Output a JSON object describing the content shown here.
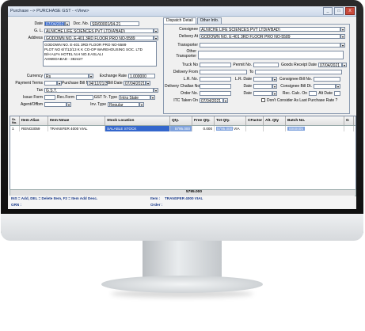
{
  "window": {
    "title": "Purchase --> PURCHASE GST - <View>",
    "minimize": "_",
    "maximize": "□",
    "close": "X"
  },
  "left": {
    "date_label": "Date",
    "date_value": "07/04/2021",
    "docno_label": "Doc. No.",
    "docno_value": "SR/00001/04-21",
    "gl_label": "G. L.",
    "gl_value": "ALNICHE LIFE SCIENCES PVT LTD(A'BAD)",
    "address_label": "Address",
    "address_line1": "GODOWN NO. E-401 3RD FLOOR PRO NO-5589",
    "address_block": [
      "GODOWN NO. E-401 3RD FLOOR PRO NO-5589",
      "PLOT NO 6/7/12/13 K K CO-OP WAREHOUSING SOC. LTD",
      "B/H ALFA HOTEL N.H NO.8 ASLALI",
      "AHMEDABAD - 382427"
    ],
    "currency_label": "Currency",
    "currency_value": "Rs",
    "exrate_label": "Exchange Rate",
    "exrate_value": "1.000000",
    "payterms_label": "Payment Terms",
    "purbill_label": "Purchase Bill No.",
    "purbill_value": "04/12/21/3/3",
    "billdate_label": "Bill Date",
    "billdate_value": "07/04/2021",
    "tax_label": "Tax",
    "tax_value": "G.S.T.",
    "issueform_label": "Issue Form",
    "recform_label": "Rec.Form",
    "gsttr_label": "GST Tr. Type",
    "gsttr_value": "Intra State",
    "agent_label": "Agent/Offbm",
    "invtype_label": "Inv. Type",
    "invtype_value": "Regular"
  },
  "tabs": [
    {
      "label": "Dispatch Detail"
    },
    {
      "label": "Other Info."
    }
  ],
  "right": {
    "consignee_label": "Consignee",
    "consignee_value": "ALNICHE LIFE SCIENCES PVT LTD(A'BAD)",
    "deliveryat_label": "Delivery At",
    "deliveryat_value": "GODOWN NO. E-401 3RD FLOOR PRO NO-5589",
    "transporter_label": "Transporter",
    "othertrans_label1": "Other",
    "othertrans_label2": "Transporter",
    "truck_label": "Truck No",
    "permit_label": "Permit No.",
    "goodsdate_label": "Goods Receipt Date",
    "goodsdate_value": "07/04/2021",
    "delfrom_label": "Delivery From",
    "to_label": "To",
    "lrno_label": "L.R. No.",
    "lrdate_label": "L.R. Date",
    "consbill_label": "Consignee Bill No.",
    "delchallan_label": "Delivery Challan No.",
    "date_label": "Date",
    "consbilldt_label": "Consignee Bill Dt.",
    "orderno_label": "Order No.",
    "order_date_label": "Date",
    "reccalc_label": "Rec. Calc. On",
    "altdate_label": "Alt Date",
    "itc_label": "ITC Taken On",
    "itc_value": "07/04/2021",
    "lastrate_label": "Don't Consider As Last Purchase Rate ?"
  },
  "grid": {
    "columns": [
      "Sr. No.",
      "Item Alias",
      "Item Nmae",
      "Stock Location",
      "Qty.",
      "Free Qty.",
      "Tot Qty.",
      "CFactor",
      "Alt. Qty",
      "Batch No.",
      "G"
    ],
    "rows": [
      {
        "sr": "1",
        "alias": "RENO3059",
        "name": "TRANSFER 4000 VIAL",
        "loc": "SALABLE STOCK",
        "qty": "5795.000",
        "free": "0.000",
        "tot": "5795.000",
        "unit": "VIA",
        "cf": "",
        "alt": "",
        "batch": "0000005",
        "g": ""
      }
    ],
    "total_qty": "5795.000"
  },
  "status": {
    "help": "INS = Add, DEL = Delete Item, F2 = Item Add Desc.",
    "item_label": "Item :",
    "item_value": "TRANSFER 4000 VIAL",
    "grn_label": "GRN :",
    "order_label": "Order :"
  }
}
